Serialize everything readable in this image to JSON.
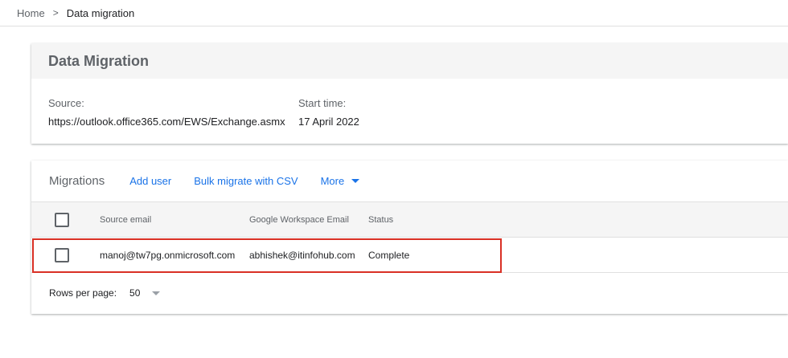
{
  "breadcrumb": {
    "home": "Home",
    "separator": ">",
    "current": "Data migration"
  },
  "summary": {
    "title": "Data Migration",
    "source_label": "Source:",
    "source_value": "https://outlook.office365.com/EWS/Exchange.asmx",
    "start_label": "Start time:",
    "start_value": "17 April 2022"
  },
  "migrations": {
    "title": "Migrations",
    "add_user": "Add user",
    "bulk_migrate": "Bulk migrate with CSV",
    "more": "More",
    "columns": {
      "source_email": "Source email",
      "workspace_email": "Google Workspace Email",
      "status": "Status"
    },
    "rows": [
      {
        "source_email": "manoj@tw7pg.onmicrosoft.com",
        "workspace_email": "abhishek@itinfohub.com",
        "status": "Complete"
      }
    ],
    "rows_per_page_label": "Rows per page:",
    "rows_per_page_value": "50"
  },
  "colors": {
    "accent": "#1a73e8",
    "highlight": "#d93025"
  }
}
